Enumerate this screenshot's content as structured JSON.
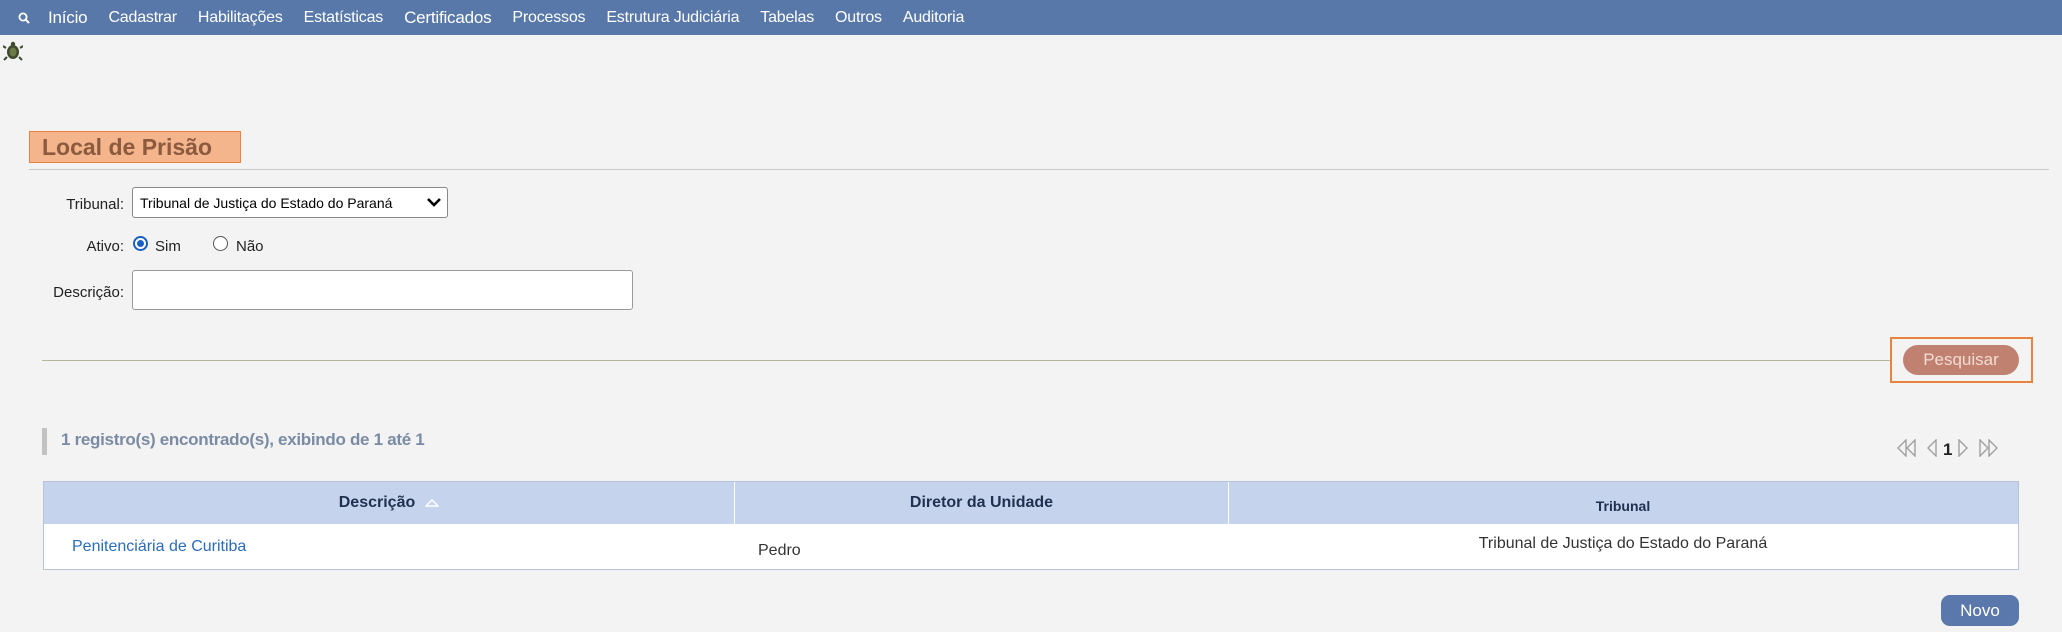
{
  "menu": {
    "items": [
      "Início",
      "Cadastrar",
      "Habilitações",
      "Estatísticas",
      "Certificados",
      "Processos",
      "Estrutura Judiciária",
      "Tabelas",
      "Outros",
      "Auditoria"
    ]
  },
  "page": {
    "title": "Local de Prisão"
  },
  "form": {
    "tribunal_label": "Tribunal:",
    "tribunal_value": "Tribunal de Justiça do Estado do Paraná",
    "ativo_label": "Ativo:",
    "ativo_sim": "Sim",
    "ativo_nao": "Não",
    "ativo_selected": "Sim",
    "descricao_label": "Descrição:",
    "descricao_value": "",
    "search_button": "Pesquisar"
  },
  "results": {
    "summary": "1 registro(s) encontrado(s), exibindo de 1 até 1",
    "current_page": "1",
    "columns": [
      "Descrição",
      "Diretor da Unidade",
      "Tribunal"
    ],
    "rows": [
      {
        "descricao": "Penitenciária de Curitiba",
        "diretor": "Pedro",
        "tribunal": "Tribunal de Justiça do Estado do Paraná"
      }
    ]
  },
  "actions": {
    "novo_button": "Novo"
  },
  "colors": {
    "nav_bg": "#5878a9",
    "title_bg": "#f4b48c",
    "title_border": "#e8833f",
    "header_bg": "#c5d4ec",
    "link": "#2b6cb8"
  }
}
